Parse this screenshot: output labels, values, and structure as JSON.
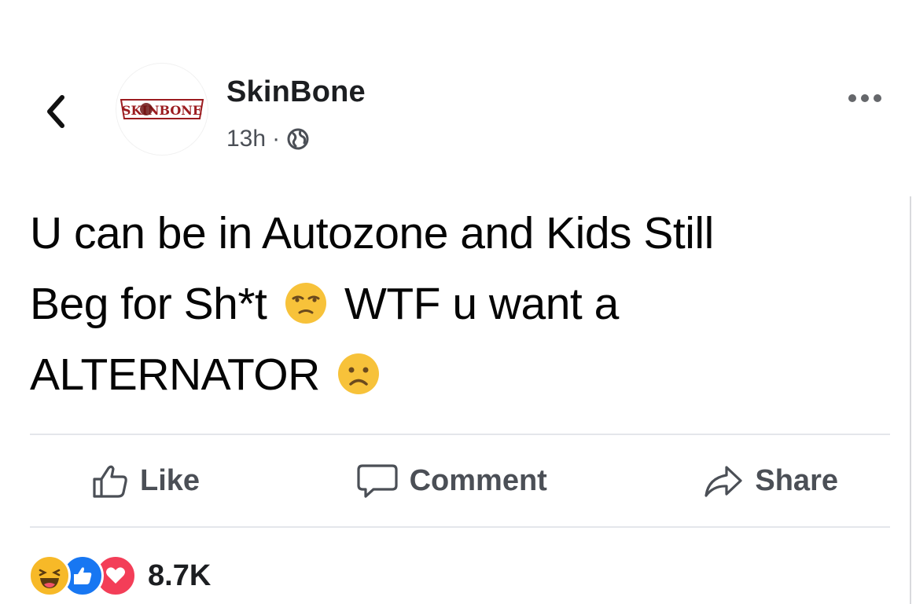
{
  "post": {
    "author": "SkinBone",
    "time": "13h",
    "separator": "·",
    "avatar_logo_text": "SKINBONE",
    "text_line1": "U can be in Autozone and Kids Still",
    "text_line2_a": "Beg for Sh*t",
    "text_line2_b": "WTF u want a",
    "text_line3": "ALTERNATOR"
  },
  "actions": {
    "like": "Like",
    "comment": "Comment",
    "share": "Share"
  },
  "reactions": {
    "count": "8.7K",
    "types": [
      "haha",
      "like",
      "love"
    ]
  },
  "icons": {
    "back": "chevron-left-icon",
    "more": "more-options-icon",
    "privacy": "globe-icon",
    "emoji_1": "unamused-face-emoji",
    "emoji_2": "frowning-face-emoji"
  },
  "colors": {
    "text": "#050505",
    "secondary": "#4b4f56",
    "like_blue": "#1877f2",
    "love_red": "#f33e58",
    "haha_yellow": "#f7b928",
    "logo_red": "#9b1b1f"
  }
}
